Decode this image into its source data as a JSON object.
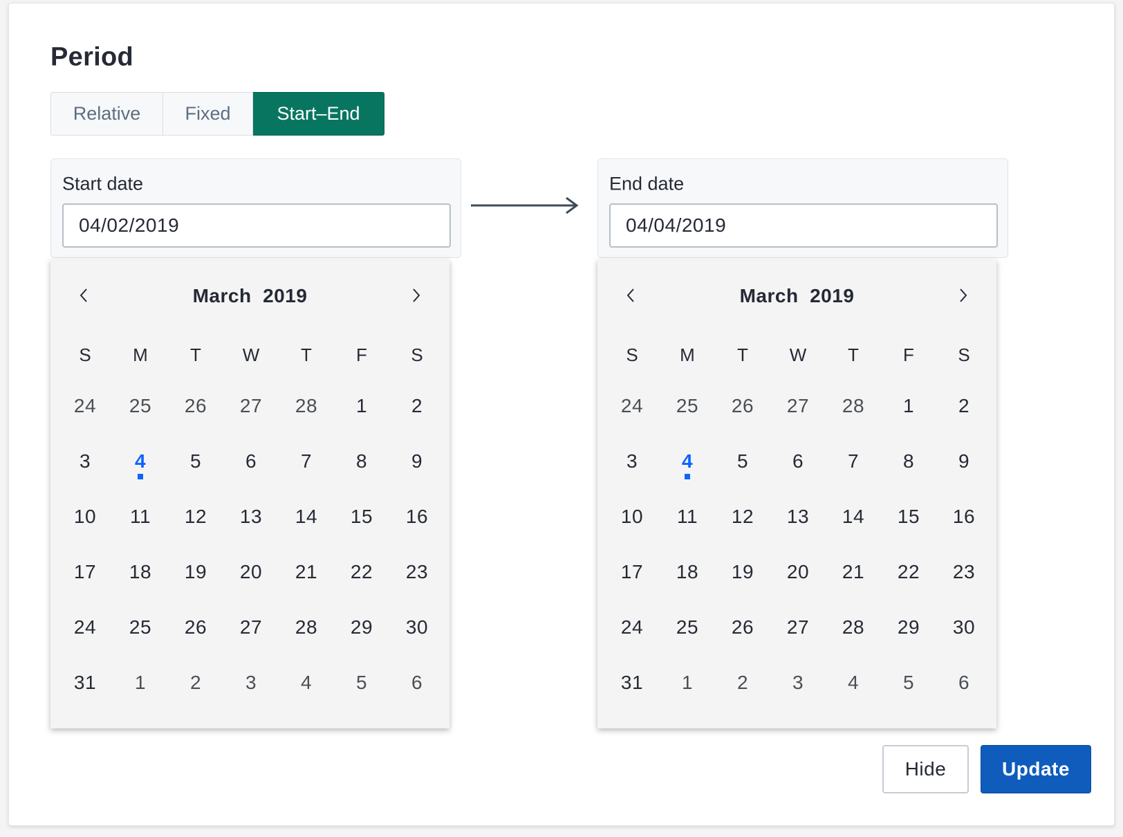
{
  "title": "Period",
  "tabs": [
    {
      "label": "Relative",
      "active": false
    },
    {
      "label": "Fixed",
      "active": false
    },
    {
      "label": "Start–End",
      "active": true
    }
  ],
  "start": {
    "label": "Start date",
    "value": "04/02/2019",
    "calendar": {
      "month": "March",
      "year": "2019",
      "title": "March  2019"
    }
  },
  "end": {
    "label": "End date",
    "value": "04/04/2019",
    "calendar": {
      "month": "March",
      "year": "2019",
      "title": "March  2019"
    }
  },
  "weekdays": [
    "S",
    "M",
    "T",
    "W",
    "T",
    "F",
    "S"
  ],
  "days": [
    {
      "label": "24",
      "other": true
    },
    {
      "label": "25",
      "other": true
    },
    {
      "label": "26",
      "other": true
    },
    {
      "label": "27",
      "other": true
    },
    {
      "label": "28",
      "other": true
    },
    {
      "label": "1"
    },
    {
      "label": "2"
    },
    {
      "label": "3"
    },
    {
      "label": "4",
      "today": true
    },
    {
      "label": "5"
    },
    {
      "label": "6"
    },
    {
      "label": "7"
    },
    {
      "label": "8"
    },
    {
      "label": "9"
    },
    {
      "label": "10"
    },
    {
      "label": "11"
    },
    {
      "label": "12"
    },
    {
      "label": "13"
    },
    {
      "label": "14"
    },
    {
      "label": "15"
    },
    {
      "label": "16"
    },
    {
      "label": "17"
    },
    {
      "label": "18"
    },
    {
      "label": "19"
    },
    {
      "label": "20"
    },
    {
      "label": "21"
    },
    {
      "label": "22"
    },
    {
      "label": "23"
    },
    {
      "label": "24"
    },
    {
      "label": "25"
    },
    {
      "label": "26"
    },
    {
      "label": "27"
    },
    {
      "label": "28"
    },
    {
      "label": "29"
    },
    {
      "label": "30"
    },
    {
      "label": "31"
    },
    {
      "label": "1",
      "other": true
    },
    {
      "label": "2",
      "other": true
    },
    {
      "label": "3",
      "other": true
    },
    {
      "label": "4",
      "other": true
    },
    {
      "label": "5",
      "other": true
    },
    {
      "label": "6",
      "other": true
    }
  ],
  "icons": {
    "prev": "chevron-left-icon",
    "next": "chevron-right-icon",
    "range": "arrow-right-icon"
  },
  "buttons": {
    "hide": "Hide",
    "update": "Update"
  },
  "colors": {
    "active_tab": "#087561",
    "primary": "#0f5cbd",
    "today": "#0f62fe",
    "text": "#252a35"
  }
}
